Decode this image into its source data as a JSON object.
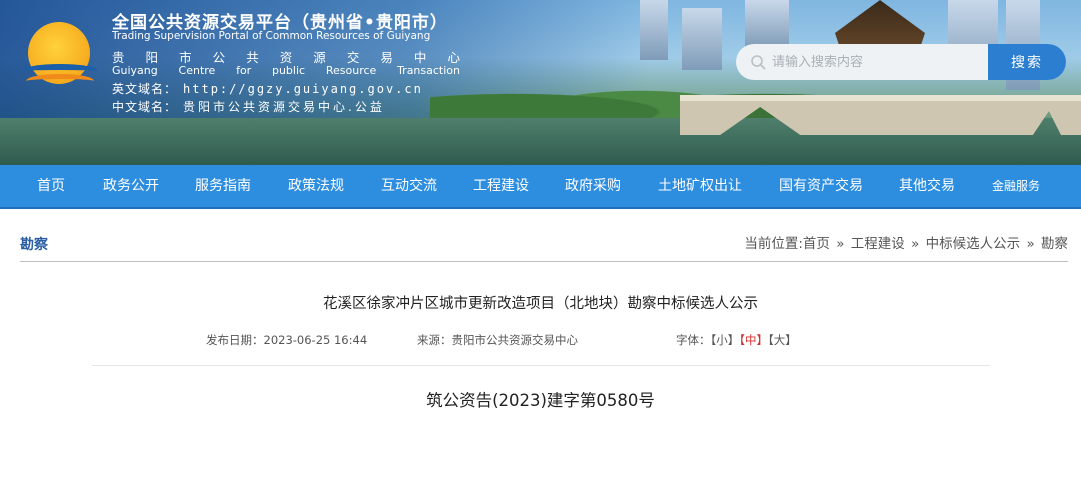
{
  "header": {
    "portal_title": "全国公共资源交易平台（贵州省•贵阳市）",
    "portal_subtitle": "Trading Supervision Portal of Common Resources of Guiyang",
    "centre_zh": [
      "贵",
      "阳",
      "市",
      "公",
      "共",
      "资",
      "源",
      "交",
      "易",
      "中",
      "心"
    ],
    "centre_en": [
      "Guiyang",
      "Centre",
      "for",
      "public",
      "Resource",
      "Transaction"
    ],
    "domain_en_label": "英文域名：",
    "domain_en_value": "http://ggzy.guiyang.gov.cn",
    "domain_zh_label": "中文域名：",
    "domain_zh_value": "贵阳市公共资源交易中心.公益"
  },
  "search": {
    "placeholder": "请输入搜索内容",
    "button_label": "搜索"
  },
  "nav": {
    "items": [
      "首页",
      "政务公开",
      "服务指南",
      "政策法规",
      "互动交流",
      "工程建设",
      "政府采购",
      "土地矿权出让",
      "国有资产交易",
      "其他交易",
      "金融服务"
    ]
  },
  "section": {
    "heading": "勘察"
  },
  "breadcrumb": {
    "prefix": "当前位置:",
    "items": [
      "首页",
      "工程建设",
      "中标候选人公示",
      "勘察"
    ],
    "separator": "»"
  },
  "article": {
    "title": "花溪区徐家冲片区城市更新改造项目（北地块）勘察中标候选人公示",
    "publish_label": "发布日期：",
    "publish_date": "2023-06-25 16:44",
    "source_label": "来源：",
    "source": "贵阳市公共资源交易中心",
    "font_label": "字体：",
    "font_small": "【小】",
    "font_medium": "【中】",
    "font_large": "【大】",
    "doc_number": "筑公资告(2023)建字第0580号"
  },
  "colors": {
    "nav_bg": "#2d8ee0",
    "search_button": "#2c7fd0",
    "heading": "#2a5fa3",
    "active_font": "#d32f2f"
  }
}
